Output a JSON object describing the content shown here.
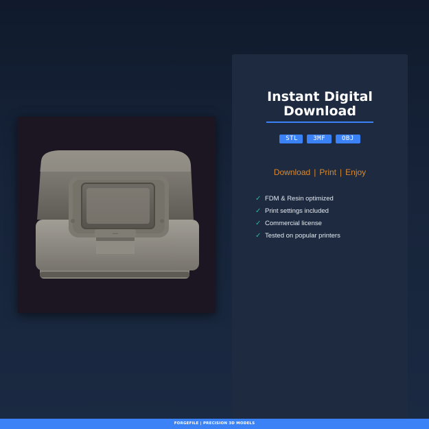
{
  "product": {
    "title_line1": "Instant Digital",
    "title_line2": "Download"
  },
  "formats": [
    "STL",
    "3MF",
    "OBJ"
  ],
  "tagline": {
    "items": [
      "Download",
      "Print",
      "Enjoy"
    ],
    "separator": "|"
  },
  "features": [
    "FDM & Resin optimized",
    "Print settings included",
    "Commercial license",
    "Tested on popular printers"
  ],
  "footer": {
    "text": "FORGEFILE | PRECISION 3D MODELS"
  },
  "icons": {
    "feature_check": "check-icon"
  },
  "colors": {
    "accent": "#3b82f6",
    "tagline": "#d98a2f",
    "check": "#2fb5a5",
    "panel": "#1d2a3f"
  }
}
